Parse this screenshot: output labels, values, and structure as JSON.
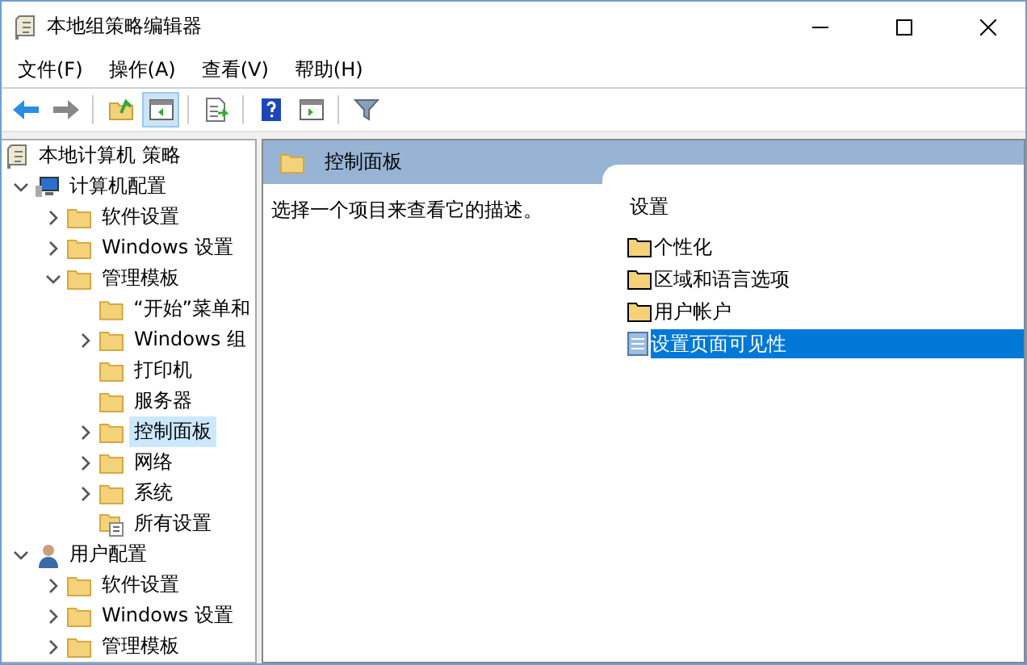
{
  "window": {
    "title": "本地组策略编辑器"
  },
  "menu": [
    "文件(F)",
    "操作(A)",
    "查看(V)",
    "帮助(H)"
  ],
  "toolbar": [
    {
      "kind": "back",
      "pressed": false
    },
    {
      "kind": "forward",
      "pressed": false
    },
    {
      "kind": "sep"
    },
    {
      "kind": "up",
      "pressed": false
    },
    {
      "kind": "pane",
      "pressed": true
    },
    {
      "kind": "sep"
    },
    {
      "kind": "export",
      "pressed": false
    },
    {
      "kind": "sep"
    },
    {
      "kind": "help",
      "pressed": false
    },
    {
      "kind": "pane2",
      "pressed": false
    },
    {
      "kind": "sep"
    },
    {
      "kind": "filter",
      "pressed": false
    }
  ],
  "tree": [
    {
      "label": "本地计算机 策略",
      "kind": "policy",
      "selected": false,
      "children": [
        {
          "label": "计算机配置",
          "kind": "computer",
          "expanded": true,
          "selected": false,
          "children": [
            {
              "label": "软件设置",
              "kind": "folder",
              "expanded": false,
              "selected": false
            },
            {
              "label": "Windows 设置",
              "kind": "folder",
              "expanded": false,
              "selected": false
            },
            {
              "label": "管理模板",
              "kind": "folder",
              "expanded": true,
              "selected": false,
              "children": [
                {
                  "label": "“开始”菜单和",
                  "kind": "folder",
                  "selected": false
                },
                {
                  "label": "Windows 组",
                  "kind": "folder",
                  "expanded": false,
                  "selected": false
                },
                {
                  "label": "打印机",
                  "kind": "folder",
                  "selected": false
                },
                {
                  "label": "服务器",
                  "kind": "folder",
                  "selected": false
                },
                {
                  "label": "控制面板",
                  "kind": "folder",
                  "expanded": false,
                  "selected": true
                },
                {
                  "label": "网络",
                  "kind": "folder",
                  "expanded": false,
                  "selected": false
                },
                {
                  "label": "系统",
                  "kind": "folder",
                  "expanded": false,
                  "selected": false
                },
                {
                  "label": "所有设置",
                  "kind": "allsettings",
                  "selected": false
                }
              ]
            }
          ]
        },
        {
          "label": "用户配置",
          "kind": "user",
          "expanded": true,
          "selected": false,
          "children": [
            {
              "label": "软件设置",
              "kind": "folder",
              "expanded": false,
              "selected": false
            },
            {
              "label": "Windows 设置",
              "kind": "folder",
              "expanded": false,
              "selected": false
            },
            {
              "label": "管理模板",
              "kind": "folder",
              "expanded": false,
              "selected": false
            }
          ]
        }
      ]
    }
  ],
  "header": {
    "title": "控制面板"
  },
  "description": "选择一个项目来查看它的描述。",
  "settings": {
    "column": "设置",
    "items": [
      {
        "label": "个性化",
        "kind": "folder",
        "selected": false
      },
      {
        "label": "区域和语言选项",
        "kind": "folder",
        "selected": false
      },
      {
        "label": "用户帐户",
        "kind": "folder",
        "selected": false
      },
      {
        "label": "设置页面可见性",
        "kind": "setting",
        "selected": true
      }
    ]
  }
}
